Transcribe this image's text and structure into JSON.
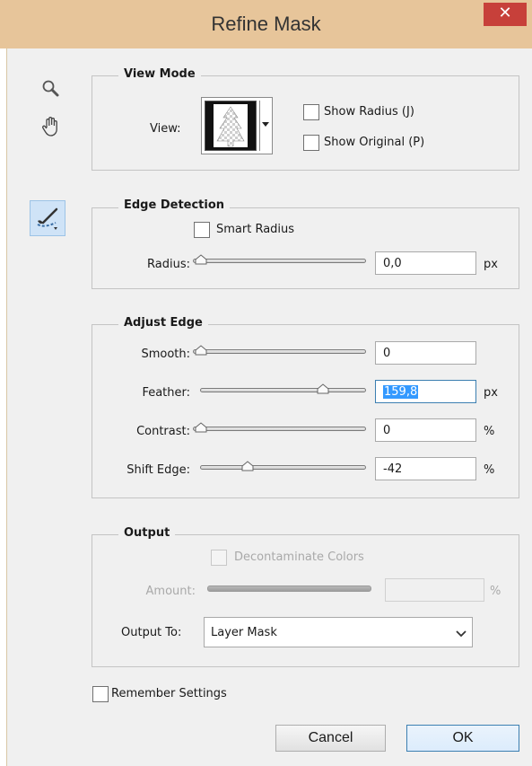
{
  "window": {
    "title": "Refine Mask",
    "close_glyph": "✕"
  },
  "tools": [
    "zoom-icon",
    "hand-icon",
    "refine-radius-brush-icon"
  ],
  "view_mode": {
    "title": "View Mode",
    "view_label": "View:",
    "show_radius": {
      "label": "Show Radius (J)",
      "checked": false
    },
    "show_original": {
      "label": "Show Original (P)",
      "checked": false
    }
  },
  "edge_detection": {
    "title": "Edge Detection",
    "smart_radius": {
      "label": "Smart Radius",
      "checked": false
    },
    "radius": {
      "label": "Radius:",
      "value": "0,0",
      "unit": "px"
    }
  },
  "adjust_edge": {
    "title": "Adjust Edge",
    "smooth": {
      "label": "Smooth:",
      "value": "0",
      "unit": ""
    },
    "feather": {
      "label": "Feather:",
      "value": "159,8",
      "unit": "px"
    },
    "contrast": {
      "label": "Contrast:",
      "value": "0",
      "unit": "%"
    },
    "shift_edge": {
      "label": "Shift Edge:",
      "value": "-42",
      "unit": "%"
    }
  },
  "output": {
    "title": "Output",
    "decontaminate": {
      "label": "Decontaminate Colors",
      "checked": false,
      "enabled": false
    },
    "amount": {
      "label": "Amount:",
      "value": "",
      "unit": "%",
      "enabled": false
    },
    "output_to": {
      "label": "Output To:",
      "value": "Layer Mask"
    }
  },
  "remember_settings": {
    "label": "Remember Settings",
    "checked": false
  },
  "buttons": {
    "cancel": "Cancel",
    "ok": "OK"
  },
  "colors": {
    "titlebar": "#e7c59a",
    "close": "#c7403a",
    "selection": "#3399ff"
  }
}
